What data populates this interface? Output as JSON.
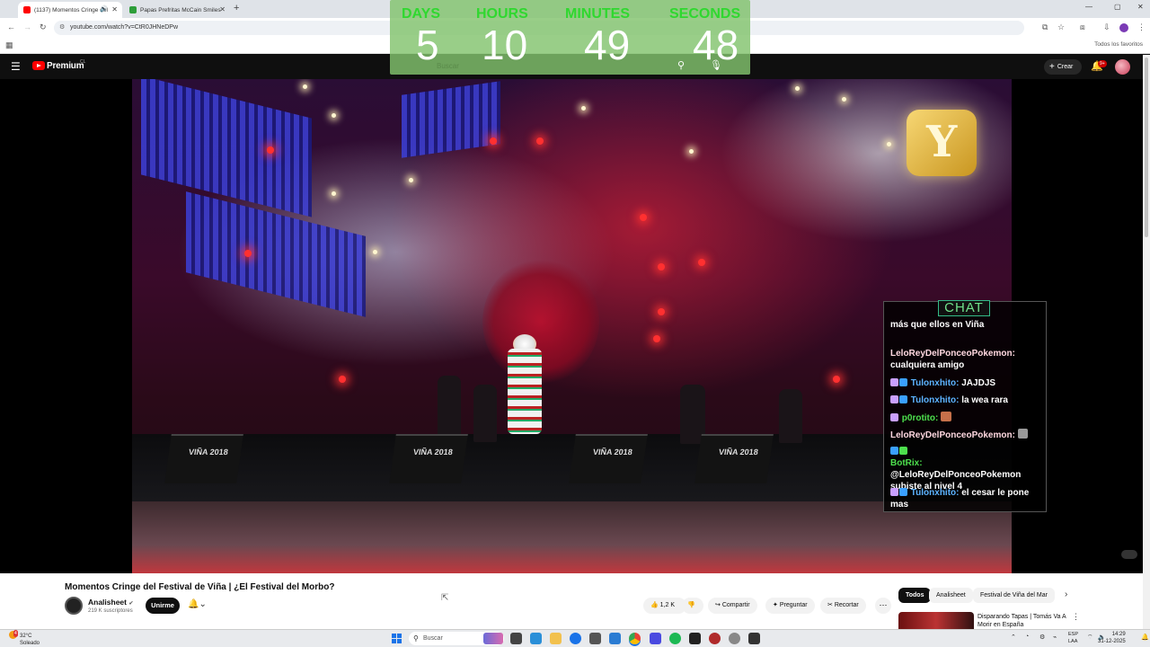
{
  "browser": {
    "tabs": [
      {
        "label": "(1137) Momentos Cringe del"
      },
      {
        "label": "Papas Prefritas McCain Smiles"
      }
    ],
    "new_tab": "+",
    "url": "youtube.com/watch?v=CtR0JHNeDPw",
    "bookmarks_right": "Todos los favoritos"
  },
  "countdown": {
    "labels": [
      "DAYS",
      "HOURS",
      "MINUTES",
      "SECONDS"
    ],
    "values": [
      "5",
      "10",
      "49",
      "48"
    ],
    "search_placeholder": "Buscar"
  },
  "youtube": {
    "brand": "Premium",
    "region": "CL",
    "create_label": "Crear",
    "notif_badge": "9+"
  },
  "chat": {
    "title": "CHAT",
    "lines": [
      {
        "user": "",
        "text": "más que ellos en Viña"
      },
      {
        "user": "LeloReyDelPonceoPokemon:",
        "text": "cualquiera amigo"
      },
      {
        "user": "Tulonxhito:",
        "text": "JAJDJS"
      },
      {
        "user": "Tulonxhito:",
        "text": "la wea rara"
      },
      {
        "user": "p0rotito:",
        "text": ""
      },
      {
        "user": "LeloReyDelPonceoPokemon:",
        "text": ""
      },
      {
        "user": "BotRix:",
        "text": "@LeloReyDelPonceoPokemon subiste al nivel 4"
      },
      {
        "user": "Tulonxhito:",
        "text": "el cesar le pone mas"
      }
    ]
  },
  "video": {
    "title": "Momentos Cringe del Festival de Viña | ¿El Festival del Morbo?",
    "channel": "Analisheet",
    "subscribers": "219 K suscriptores",
    "join_label": "Unirme",
    "likes": "1,2 K",
    "share_label": "Compartir",
    "ask_label": "Preguntar",
    "clip_label": "Recortar",
    "stage_logo_text": "VIÑA 2018"
  },
  "related": {
    "chips": [
      "Todos",
      "Analisheet",
      "Festival de Viña del Mar"
    ],
    "first_title": "Disparando Tapas | Tomás Va A Morir en España"
  },
  "taskbar": {
    "weather_temp": "32°C",
    "weather_desc": "Soleado",
    "search_label": "Buscar",
    "lang_1": "ESP",
    "lang_2": "LAA",
    "time": "14:29",
    "date": "31-12-2025",
    "weather_badge": "4"
  }
}
